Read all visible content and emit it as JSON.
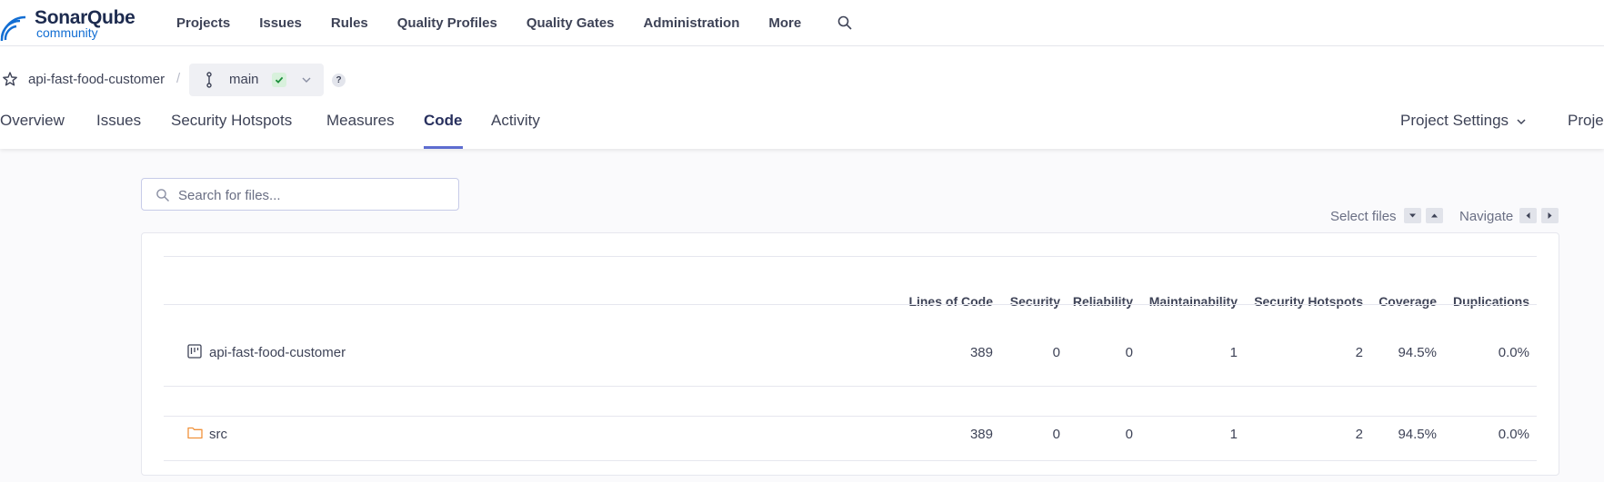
{
  "brand": {
    "name_part1": "Sonar",
    "name_part2": "Qube",
    "edition": "community",
    "accent": "#126ed3"
  },
  "topnav": {
    "items": [
      "Projects",
      "Issues",
      "Rules",
      "Quality Profiles",
      "Quality Gates",
      "Administration",
      "More"
    ],
    "search_icon": "search-icon"
  },
  "project": {
    "name": "api-fast-food-customer",
    "separator": "/",
    "branch": "main",
    "branch_status": "passed",
    "help": "?"
  },
  "tabs": {
    "items": [
      "Overview",
      "Issues",
      "Security Hotspots",
      "Measures",
      "Code",
      "Activity"
    ],
    "active": "Code",
    "right": [
      "Project Settings",
      "Proje"
    ]
  },
  "code": {
    "search_placeholder": "Search for files...",
    "select_files_label": "Select files",
    "navigate_label": "Navigate",
    "columns": [
      "Lines of Code",
      "Security",
      "Reliability",
      "Maintainability",
      "Security Hotspots",
      "Coverage",
      "Duplications"
    ],
    "rows": [
      {
        "name": "api-fast-food-customer",
        "icon": "project-icon",
        "values": [
          "389",
          "0",
          "0",
          "1",
          "2",
          "94.5%",
          "0.0%"
        ]
      },
      {
        "name": "src",
        "icon": "folder-icon",
        "values": [
          "389",
          "0",
          "0",
          "1",
          "2",
          "94.5%",
          "0.0%"
        ]
      }
    ]
  }
}
